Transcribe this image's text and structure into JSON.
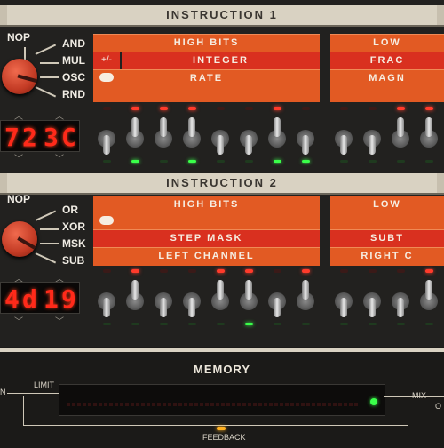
{
  "instr1": {
    "title": "INSTRUCTION 1",
    "ops": [
      "NOP",
      "AND",
      "MUL",
      "OSC",
      "RND"
    ],
    "display": [
      "7",
      "2",
      "3",
      "C"
    ],
    "rows": {
      "high_bits": "HIGH BITS",
      "integer": "INTEGER",
      "rate": "RATE",
      "plusminus": "+/-",
      "low": "LOW",
      "frac": "FRAC",
      "magn": "MAGN"
    }
  },
  "instr2": {
    "title": "INSTRUCTION 2",
    "ops": [
      "NOP",
      "OR",
      "XOR",
      "MSK",
      "SUB"
    ],
    "display": [
      "4",
      "d",
      "1",
      "9"
    ],
    "rows": {
      "high_bits": "HIGH BITS",
      "step_mask": "STEP MASK",
      "left_channel": "LEFT CHANNEL",
      "low": "LOW",
      "subt": "SUBT",
      "right": "RIGHT C"
    }
  },
  "memory": {
    "title": "MEMORY",
    "limit": "LIMIT",
    "mix": "MIX",
    "feedback": "FEEDBACK",
    "in": "N",
    "out": "O"
  },
  "colors": {
    "orange": "#e25a23",
    "red": "#d9301f",
    "led_red": "#ff3b2b",
    "led_green": "#3aff4a"
  },
  "toggles1_up": [
    false,
    true,
    true,
    true,
    false,
    false,
    true,
    false,
    false,
    false,
    true,
    true
  ],
  "toggles2_up": [
    false,
    true,
    false,
    false,
    true,
    true,
    false,
    true,
    false,
    false,
    false,
    true
  ],
  "leds1": [
    false,
    true,
    true,
    true,
    false,
    false,
    true,
    false,
    false,
    false,
    true,
    true
  ],
  "gleds1": [
    false,
    true,
    false,
    true,
    false,
    false,
    true,
    true,
    false,
    false,
    false,
    false
  ],
  "leds2": [
    false,
    true,
    false,
    false,
    true,
    true,
    false,
    true,
    false,
    false,
    false,
    true
  ],
  "gleds2": [
    false,
    false,
    false,
    false,
    false,
    true,
    false,
    false,
    false,
    false,
    false,
    false
  ]
}
